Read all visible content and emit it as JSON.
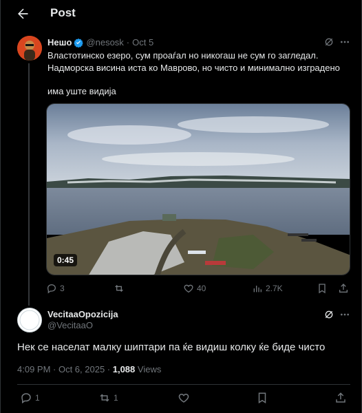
{
  "header": {
    "title": "Post"
  },
  "tweet": {
    "display_name": "Нешо",
    "handle": "@nesosk",
    "separator": "·",
    "date": "Oct 5",
    "text_line1": "Властотинско езеро, сум проаѓал но никогаш не сум го загледал. Надморска висина иста ко Маврово, но чисто и минимално изградено",
    "text_line2": "има уште видија",
    "video_duration": "0:45",
    "replies": "3",
    "reposts": "",
    "likes": "40",
    "views": "2.7K"
  },
  "reply": {
    "display_name": "VecitaaOpozicija",
    "handle": "@VecitaaO",
    "text": "Нек се населат малку шиптари па ќе видиш колку ќе биде чисто",
    "time": "4:09 PM · Oct 6, 2025 · ",
    "view_count": "1,088",
    "views_label": " Views",
    "replies": "1",
    "reposts": "1"
  },
  "colors": {
    "background": "#000000",
    "text_primary": "#e7e9ea",
    "text_secondary": "#71767b",
    "verified": "#1d9bf0",
    "border": "#2f3336"
  }
}
